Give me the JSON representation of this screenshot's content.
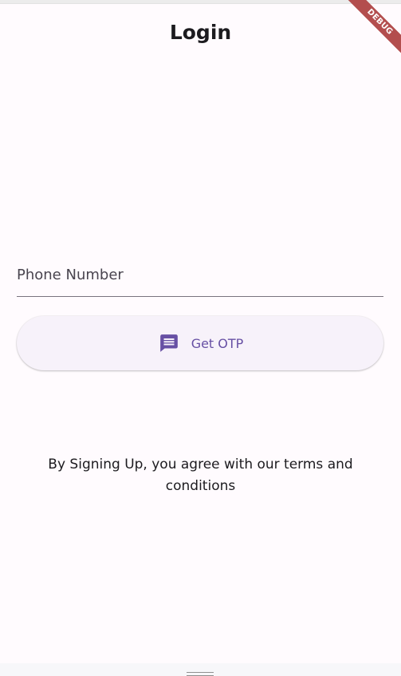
{
  "app_bar": {
    "title": "Login"
  },
  "debug_banner": {
    "label": "DEBUG",
    "color": "#b34e4e"
  },
  "phone_field": {
    "placeholder": "Phone Number",
    "value": ""
  },
  "otp_button": {
    "label": "Get OTP",
    "icon": "message-icon",
    "accent_color": "#6750a4"
  },
  "terms": {
    "text": "By Signing Up, you agree with our terms and conditions"
  },
  "system_nav": {
    "handle_icon": "gesture-handle-icon"
  },
  "colors": {
    "background": "#fffbfe",
    "button_surface": "#f7f2fa",
    "field_underline": "#79747e"
  }
}
